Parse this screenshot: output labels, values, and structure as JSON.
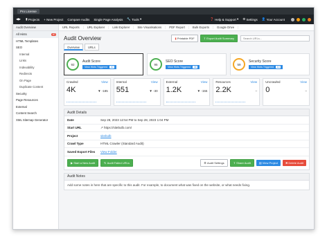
{
  "app": {
    "license": "Pro License"
  },
  "topnav": {
    "items": [
      "Projects",
      "New Project",
      "Compare Audits",
      "Single Page Analysis",
      "Tools"
    ],
    "right": [
      "Help & Support",
      "Settings",
      "Your Account"
    ]
  },
  "subnav": {
    "left": "Audit Overview",
    "items": [
      "URL Reports",
      "URL Explorer",
      "Link Explorer",
      "Site Visualisations",
      "PDF Report",
      "Bulk Exports",
      "Google Drive"
    ]
  },
  "sidebar": {
    "items": [
      {
        "label": "All Hints",
        "sub": false,
        "badge": "40"
      },
      {
        "label": "HTML Templates",
        "sub": false
      },
      {
        "label": "SEO",
        "sub": false
      },
      {
        "label": "Internal",
        "sub": true
      },
      {
        "label": "Links",
        "sub": true
      },
      {
        "label": "Indexability",
        "sub": true
      },
      {
        "label": "Redirects",
        "sub": true
      },
      {
        "label": "On Page",
        "sub": true
      },
      {
        "label": "Duplicate Content",
        "sub": true
      },
      {
        "label": "Security",
        "sub": false
      },
      {
        "label": "Page Resources",
        "sub": false
      },
      {
        "label": "External",
        "sub": false
      },
      {
        "label": "Content Search",
        "sub": false
      },
      {
        "label": "XML Sitemap Generator",
        "sub": false
      }
    ]
  },
  "main": {
    "title": "Audit Overview",
    "printable_pdf": "Printable PDF",
    "export_summary": "Export Audit Summary",
    "filter_placeholder": "Search URLs...",
    "tabs": [
      "Overview",
      "URLs"
    ]
  },
  "scores": [
    {
      "title": "Audit Score",
      "value": "92",
      "btn": "View Hints Triggered",
      "count": "40",
      "color": "#4caf50"
    },
    {
      "title": "SEO Score",
      "value": "95",
      "btn": "View Hints Triggered",
      "count": "38",
      "color": "#4caf50"
    },
    {
      "title": "Security Score",
      "value": "59",
      "btn": "View Hints Triggered",
      "count": "10",
      "color": "#f5a623"
    }
  ],
  "metrics": [
    {
      "title": "Crawled",
      "view": "View",
      "value": "4K",
      "delta": "▼ -185"
    },
    {
      "title": "Internal",
      "view": "View",
      "value": "551",
      "delta": "▼ -30"
    },
    {
      "title": "External",
      "view": "View",
      "value": "1.2K",
      "delta": "▼ -155"
    },
    {
      "title": "Resources",
      "view": "View",
      "value": "2.2K",
      "delta": "–"
    },
    {
      "title": "Uncrawled",
      "view": "View",
      "value": "0",
      "delta": "–"
    }
  ],
  "details": {
    "heading": "Audit Details",
    "rows": [
      {
        "k": "Date",
        "v": "Sep 28, 2023 12:54 PM to Sep 28, 2023 1:04 PM",
        "link": false
      },
      {
        "k": "Start URL",
        "v": "https://sitebulb.com/",
        "link": false
      },
      {
        "k": "Project",
        "v": "sitebulb",
        "link": true
      },
      {
        "k": "Crawl Type",
        "v": "HTML Crawler (Standard Audit)",
        "link": false
      },
      {
        "k": "Saved Export Files",
        "v": "View Folder",
        "link": true
      }
    ]
  },
  "actions": {
    "start_new": "Start a New Audit",
    "audit_failed": "Audit Failed URLs",
    "settings": "Audit Settings",
    "share": "Share Audit",
    "view_project": "View Project",
    "delete": "Delete Audit"
  },
  "notes": {
    "heading": "Audit Notes",
    "text": "Add some notes in here that are specific to this audit. For example, to document what was fixed on the website, or what needs fixing."
  }
}
